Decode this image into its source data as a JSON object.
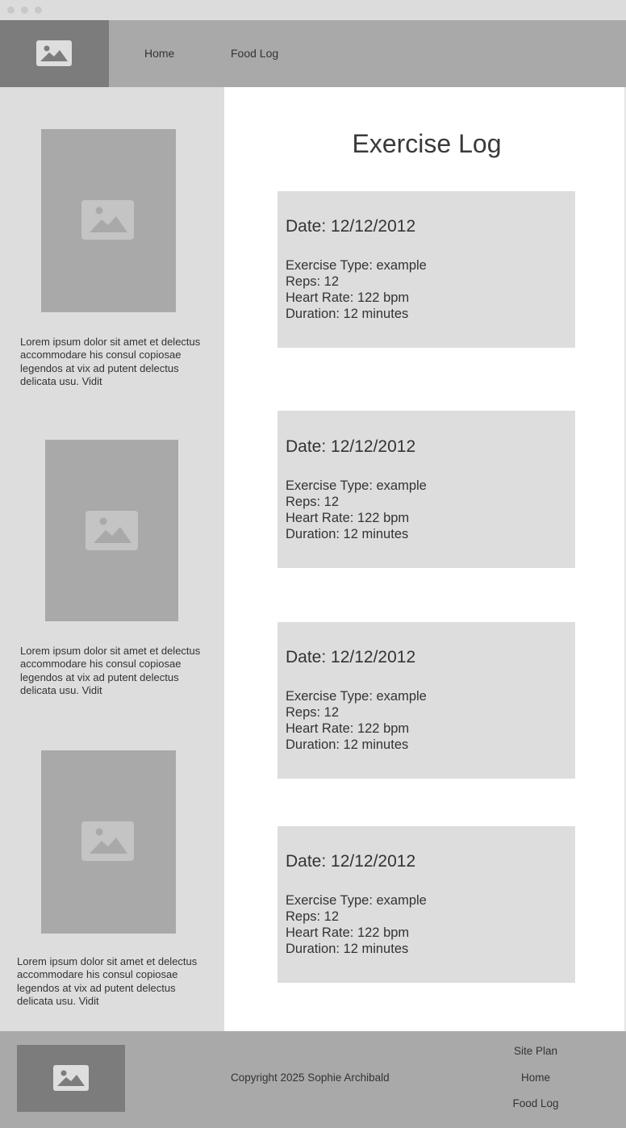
{
  "nav": {
    "home_label": "Home",
    "food_log_label": "Food Log"
  },
  "sidebar": {
    "items": [
      {
        "text": "Lorem ipsum dolor sit amet et delectus accommodare his consul copiosae legendos at vix ad putent delectus delicata usu. Vidit"
      },
      {
        "text": "Lorem ipsum dolor sit amet et delectus accommodare his consul copiosae legendos at vix ad putent delectus delicata usu. Vidit"
      },
      {
        "text": "Lorem ipsum dolor sit amet et delectus accommodare his consul copiosae legendos at vix ad putent delectus delicata usu. Vidit"
      }
    ]
  },
  "main": {
    "title": "Exercise Log",
    "entries": [
      {
        "date": "Date: 12/12/2012",
        "exercise_type": "Exercise Type: example",
        "reps": "Reps: 12",
        "heart_rate": "Heart Rate: 122 bpm",
        "duration": "Duration: 12 minutes"
      },
      {
        "date": "Date: 12/12/2012",
        "exercise_type": "Exercise Type: example",
        "reps": "Reps: 12",
        "heart_rate": "Heart Rate: 122 bpm",
        "duration": "Duration: 12 minutes"
      },
      {
        "date": "Date: 12/12/2012",
        "exercise_type": "Exercise Type: example",
        "reps": "Reps: 12",
        "heart_rate": "Heart Rate: 122 bpm",
        "duration": "Duration: 12 minutes"
      },
      {
        "date": "Date: 12/12/2012",
        "exercise_type": "Exercise Type: example",
        "reps": "Reps: 12",
        "heart_rate": "Heart Rate: 122 bpm",
        "duration": "Duration: 12 minutes"
      }
    ]
  },
  "footer": {
    "copyright": "Copyright 2025 Sophie Archibald",
    "links": [
      "Site Plan",
      "Home",
      "Food Log"
    ]
  },
  "icons": {
    "placeholder": "image-placeholder-icon"
  },
  "colors": {
    "header_bg": "#a9a9a9",
    "logo_bg": "#7c7c7c",
    "sidebar_bg": "#dddddd",
    "card_bg": "#dddddd",
    "text": "#333333"
  }
}
